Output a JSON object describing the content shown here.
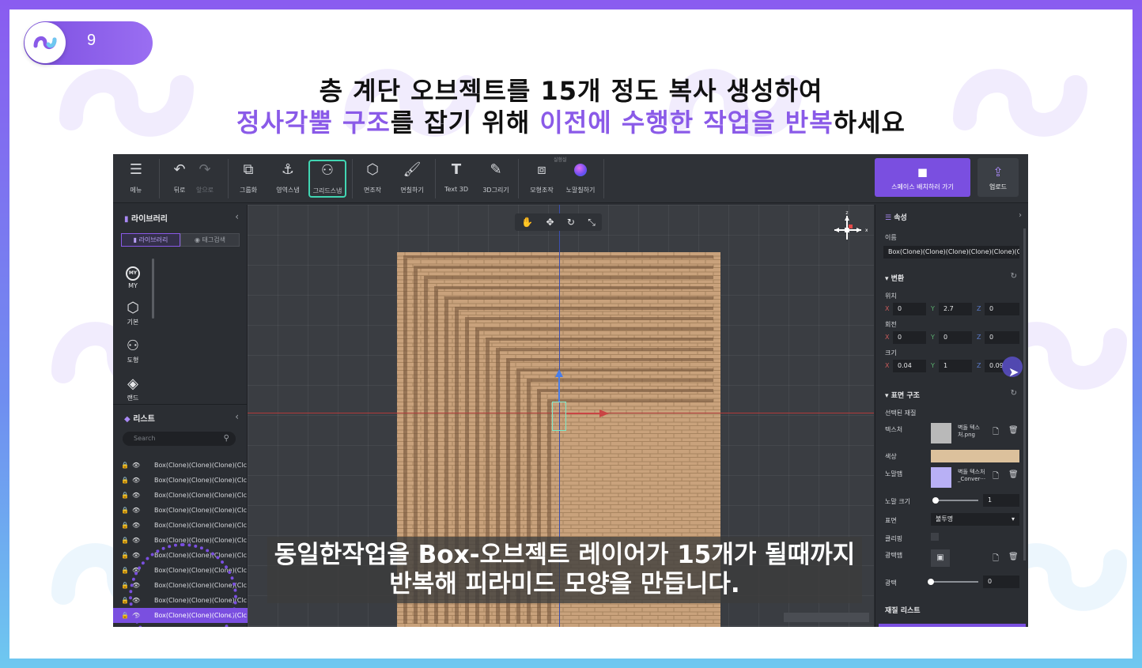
{
  "slide": {
    "page_number": "9",
    "title_line1": "층 계단 오브젝트를 15개 정도 복사 생성하여",
    "title_line2_a": "정사각뿔 구조",
    "title_line2_b": "를 잡기 위해 ",
    "title_line2_c": "이전에 수행한 작업을 반복",
    "title_line2_d": "하세요",
    "accent_color": "#8a5ae8"
  },
  "toolbar": {
    "menu": "메뉴",
    "undo": "뒤로",
    "redo": "앞으로",
    "group": "그룹화",
    "area_snap": "영역스냅",
    "grid_snap": "그리드스냅",
    "face_edit": "면조작",
    "face_paint": "면칠하기",
    "text3d": "Text 3D",
    "draw3d": "3D그리기",
    "model_edit": "모형조작",
    "normal_paint": "노말칠하기",
    "tiny_label": "실험실",
    "space_button": "스페이스 배치하러 가기",
    "upload_button": "업로드"
  },
  "library": {
    "title": "라이브러리",
    "tab_library": "라이브러리",
    "tab_tag_search": "태그검색",
    "categories": [
      {
        "label": "MY",
        "icon": "my-icon"
      },
      {
        "label": "기본",
        "icon": "cube-icon"
      },
      {
        "label": "도형",
        "icon": "shapes-icon"
      },
      {
        "label": "랜드",
        "icon": "land-icon"
      }
    ]
  },
  "list": {
    "title": "리스트",
    "search_placeholder": "Search",
    "items": [
      "Box(Clone)(Clone)(Clone)(Clc",
      "Box(Clone)(Clone)(Clone)(Clc",
      "Box(Clone)(Clone)(Clone)(Clc",
      "Box(Clone)(Clone)(Clone)(Clc",
      "Box(Clone)(Clone)(Clone)(Clc",
      "Box(Clone)(Clone)(Clone)(Clc",
      "Box(Clone)(Clone)(Clone)(Clc",
      "Box(Clone)(Clone)(Clone)(Clc",
      "Box(Clone)(Clone)(Clone)(Clc",
      "Box(Clone)(Clone)(Clone)(Clc",
      "Box(Clone)(Clone)(Clone)(Clc"
    ]
  },
  "viewport": {
    "subtitle_line1": "동일한작업을 Box-오브젝트 레이어가 15개가 될때까지",
    "subtitle_line2": "반복해 피라미드 모양을 만듭니다.",
    "gizmo_z": "z",
    "gizmo_x": "x"
  },
  "properties": {
    "title": "속성",
    "name_label": "이름",
    "name_value": "Box(Clone)(Clone)(Clone)(Clone)(Clone)(C",
    "transform_label": "변환",
    "position_label": "위치",
    "position": {
      "x": "0",
      "y": "2.7",
      "z": "0"
    },
    "rotation_label": "회전",
    "rotation": {
      "x": "0",
      "y": "0",
      "z": "0"
    },
    "scale_label": "크기",
    "scale": {
      "x": "0.04",
      "y": "1",
      "z": "0.09"
    },
    "axis_x": "X",
    "axis_y": "Y",
    "axis_z": "Z",
    "surface_label": "표면 구조",
    "selected_material_label": "선택된 재질",
    "texture_label": "텍스처",
    "texture_file": "벽돌 텍스\n처.png",
    "color_label": "색상",
    "color_value": "#dcc19c",
    "normal_map_label": "노말맵",
    "normal_map_file": "벽돌 텍스처\n_Conver···",
    "normal_size_label": "노말 크기",
    "normal_size_value": "1",
    "surface_mode_label": "표면",
    "surface_mode_value": "불투명",
    "clipping_label": "클리핑",
    "light_map_label": "광택맵",
    "gloss_label": "광택",
    "gloss_value": "0",
    "material_list_label": "재질 리스트"
  }
}
